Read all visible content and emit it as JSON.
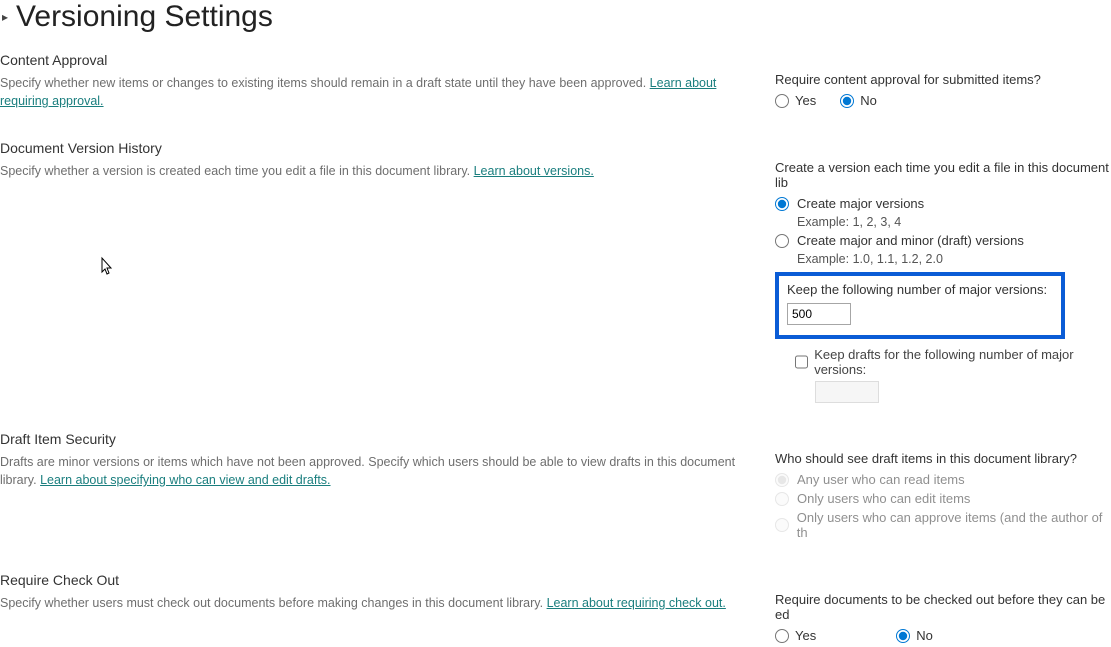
{
  "page": {
    "title": "Versioning Settings"
  },
  "contentApproval": {
    "heading": "Content Approval",
    "desc": "Specify whether new items or changes to existing items should remain in a draft state until they have been approved.  ",
    "link": "Learn about requiring approval.",
    "question": "Require content approval for submitted items?",
    "yes": "Yes",
    "no": "No"
  },
  "versionHistory": {
    "heading": "Document Version History",
    "desc": "Specify whether a version is created each time you edit a file in this document library.  ",
    "link": "Learn about versions.",
    "question": "Create a version each time you edit a file in this document lib",
    "opt1": "Create major versions",
    "opt1ex": "Example: 1, 2, 3, 4",
    "opt2": "Create major and minor (draft) versions",
    "opt2ex": "Example: 1.0, 1.1, 1.2, 2.0",
    "keepMajorLabel": "Keep the following number of major versions:",
    "keepMajorValue": "500",
    "keepDraftsLabel": "Keep drafts for the following number of major versions:"
  },
  "draftSecurity": {
    "heading": "Draft Item Security",
    "desc": "Drafts are minor versions or items which have not been approved. Specify which users should be able to view drafts in this document library.  ",
    "link": "Learn about specifying who can view and edit drafts.",
    "question": "Who should see draft items in this document library?",
    "opt1": "Any user who can read items",
    "opt2": "Only users who can edit items",
    "opt3": "Only users who can approve items (and the author of th"
  },
  "requireCheckout": {
    "heading": "Require Check Out",
    "desc": "Specify whether users must check out documents before making changes in this document library.  ",
    "link": "Learn about requiring check out.",
    "question": "Require documents to be checked out before they can be ed",
    "yes": "Yes",
    "no": "No"
  }
}
